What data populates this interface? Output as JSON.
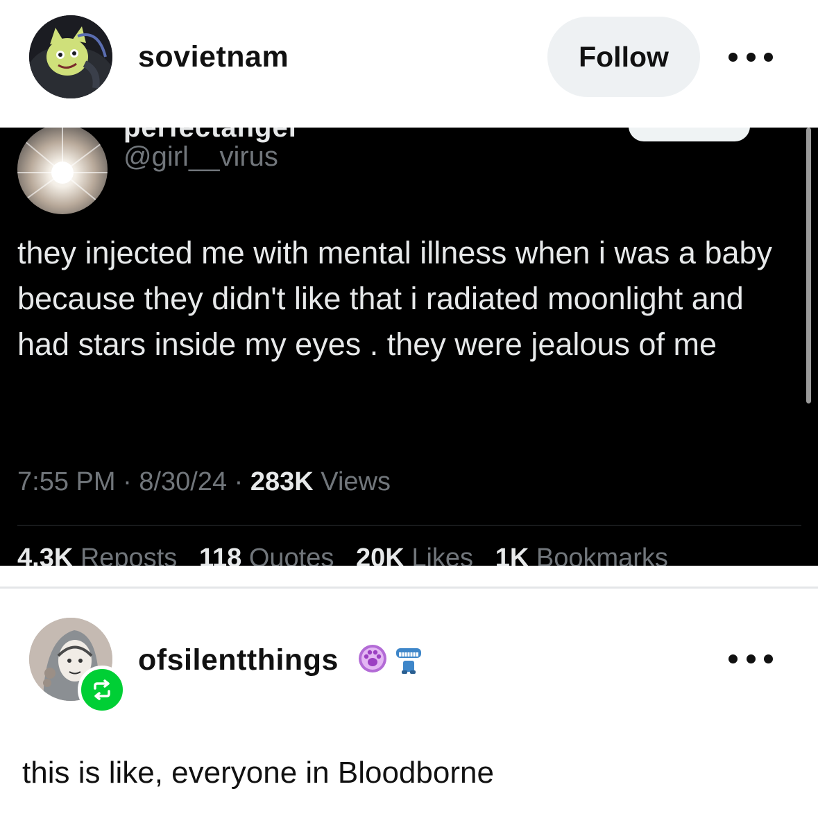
{
  "post": {
    "username": "sovietnam",
    "follow_label": "Follow",
    "more_icon": "more-dots-icon"
  },
  "tweet": {
    "display_name": "perfectangel",
    "handle": "@girl__virus",
    "text": "they injected me with mental illness when i was a baby because they didn't like that i radiated moonlight and had stars inside my eyes . they were jealous of me",
    "time": "7:55 PM",
    "date": "8/30/24",
    "views_count": "283K",
    "views_label": "Views",
    "reposts_count": "4.3K",
    "reposts_label": "Reposts",
    "quotes_count": "118",
    "quotes_label": "Quotes",
    "likes_count": "20K",
    "likes_label": "Likes",
    "bookmarks_count": "1K",
    "bookmarks_label": "Bookmarks"
  },
  "reblog": {
    "username": "ofsilentthings",
    "text": "this is like, everyone in Bloodborne",
    "badge_icons": [
      "paw-badge-icon",
      "dentures-badge-icon"
    ],
    "reblog_icon": "reblog-icon"
  },
  "colors": {
    "reblog_green": "#00cf35",
    "follow_bg": "#eef1f3",
    "tweet_bg": "#000000",
    "tweet_secondary": "#71767b",
    "paw_purple": "#b36bd6"
  }
}
